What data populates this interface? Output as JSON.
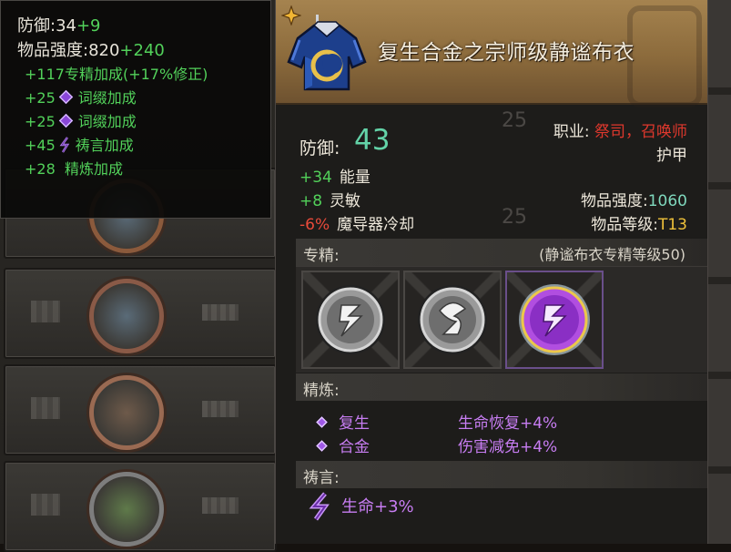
{
  "compare": {
    "armor_label": "防御:34",
    "armor_bonus": "+9",
    "power_label": "物品强度:820",
    "power_bonus": "+240",
    "lines": [
      {
        "text": "+117专精加成(+17%修正)",
        "icon": "none"
      },
      {
        "text": "+25",
        "icon": "purple-gem-icon",
        "suffix": "词缀加成"
      },
      {
        "text": "+25",
        "icon": "purple-gem-icon",
        "suffix": "词缀加成"
      },
      {
        "text": "+45",
        "icon": "prayer-icon",
        "suffix": "祷言加成"
      },
      {
        "text": "+28  精炼加成",
        "icon": "none"
      }
    ]
  },
  "item": {
    "title": "复生合金之宗师级静谧布衣",
    "icon": "robe-icon",
    "armor_label": "防御:",
    "armor_value": "43",
    "class_label": "职业:",
    "classes": "祭司，召唤师",
    "type": "护甲",
    "stats": [
      {
        "value": "+34",
        "name": "能量",
        "sign": "pos"
      },
      {
        "value": "+8",
        "name": "灵敏",
        "sign": "pos"
      },
      {
        "value": "-6%",
        "name": "魔导器冷却",
        "sign": "neg"
      }
    ],
    "power_label": "物品强度:",
    "power_value": "1060",
    "level_label": "物品等级:",
    "level_value": "T13"
  },
  "spec": {
    "label": "专精:",
    "note": "(静谧布衣专精等级50)",
    "slots": [
      {
        "icon": "silver-rune-icon",
        "state": "inactive"
      },
      {
        "icon": "silver-rune-icon",
        "state": "inactive"
      },
      {
        "icon": "purple-rune-icon",
        "state": "active"
      }
    ]
  },
  "refine": {
    "label": "精炼:",
    "items": [
      {
        "name": "复生",
        "effect": "生命恢复+4%"
      },
      {
        "name": "合金",
        "effect": "伤害减免+4%"
      }
    ]
  },
  "prayer": {
    "label": "祷言:",
    "text": "生命+3%"
  },
  "colors": {
    "positive": "#52d15a",
    "negative": "#e84a3a",
    "class": "#e0382d",
    "purple": "#c77df2",
    "tier": "#f0c23a"
  }
}
